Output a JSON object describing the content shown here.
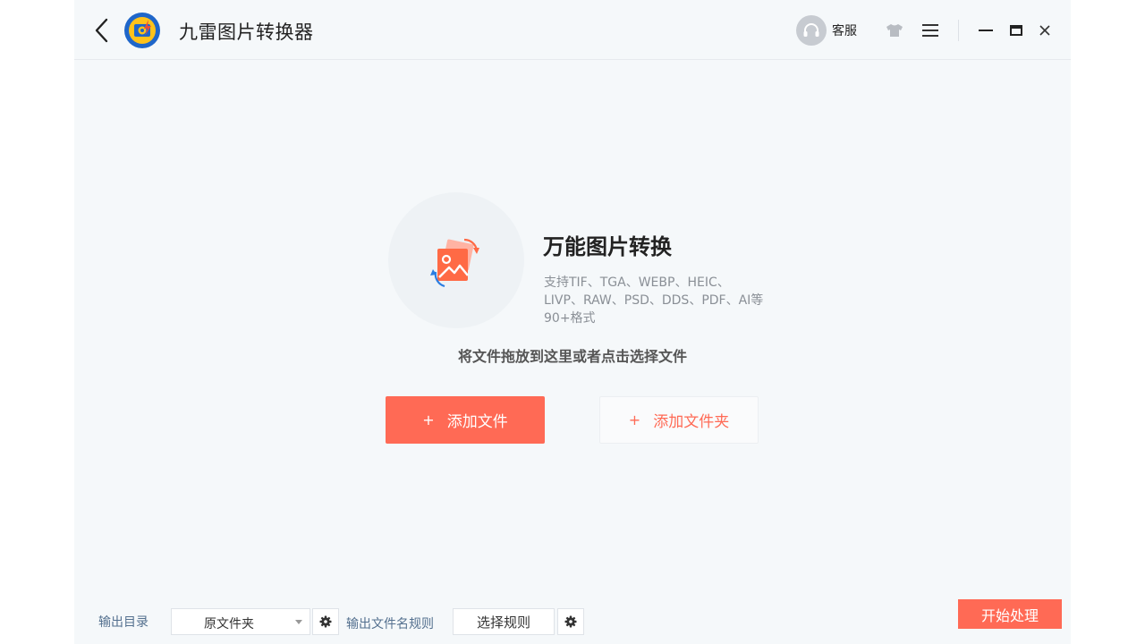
{
  "window": {
    "title": "九雷图片转换器",
    "support_label": "客服",
    "icons": [
      "back-icon",
      "app-logo-icon",
      "headset-icon",
      "skin-icon",
      "menu-icon",
      "minimize-icon",
      "maximize-icon",
      "close-icon"
    ]
  },
  "hero": {
    "title": "万能图片转换",
    "description": "支持TIF、TGA、WEBP、HEIC、LIVP、RAW、PSD、DDS、PDF、AI等90+格式",
    "drop_hint": "将文件拖放到这里或者点击选择文件"
  },
  "actions": {
    "add_file_plus": "+",
    "add_file_label": "添加文件",
    "add_folder_plus": "+",
    "add_folder_label": "添加文件夹"
  },
  "footer": {
    "output_dir_label": "输出目录",
    "output_dir_value": "原文件夹",
    "filename_rule_label": "输出文件名规则",
    "rule_button_label": "选择规则",
    "start_button_label": "开始处理"
  },
  "colors": {
    "accent": "#ff6a55",
    "background": "#f5f8fa",
    "label_blue": "#54708f"
  }
}
